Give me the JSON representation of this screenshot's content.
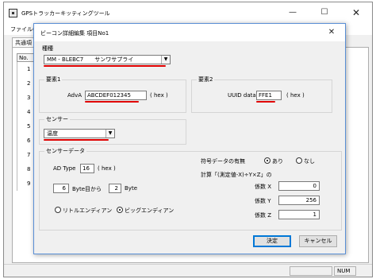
{
  "main_window": {
    "title": "GPSトラッカーキッティングツール",
    "menu_file": "ファイル(",
    "tab_label": "共通項",
    "table_header": "No.",
    "row_numbers": [
      "1",
      "2",
      "3",
      "4",
      "5",
      "6",
      "7",
      "8",
      "9"
    ],
    "status_num": "NUM"
  },
  "dialog": {
    "title": "ビーコン詳細編集 項目No1",
    "type_group": {
      "title": "種種",
      "combo_value": "MM - BLEBC7　　サンワサプライ"
    },
    "element1": {
      "title": "要素1",
      "label": "AdvA",
      "value": "ABCDEF012345",
      "unit": "( hex )"
    },
    "element2": {
      "title": "要素2",
      "label": "UUID data",
      "value": "FFE1",
      "unit": "( hex )"
    },
    "sensor": {
      "title": "センサー",
      "value": "温度"
    },
    "sensor_data": {
      "title": "センサーデータ",
      "ad_type_label": "AD Type",
      "ad_type_value": "16",
      "ad_type_unit": "( hex )",
      "byte_start_value": "6",
      "byte_start_label": "Byte目から",
      "byte_len_value": "2",
      "byte_len_label": "Byte",
      "little_endian_label": "リトルエンディアン",
      "big_endian_label": "ビッグエンディアン",
      "sign_label": "符号データの有無",
      "sign_yes": "あり",
      "sign_no": "なし",
      "formula_label": "計算「(測定値-X)÷Y×Z」の",
      "coef_x_label": "係数 X",
      "coef_x_value": "0",
      "coef_y_label": "係数 Y",
      "coef_y_value": "256",
      "coef_z_label": "係数 Z",
      "coef_z_value": "1"
    },
    "ok_label": "決定",
    "cancel_label": "キャンセル"
  },
  "colors": {
    "highlight_underline": "#e00000",
    "dialog_border": "#5a8fd6",
    "default_button_border": "#0078d7"
  },
  "icons": {
    "app": "app-icon",
    "minimize": "minimize-icon",
    "maximize": "maximize-icon",
    "close": "close-icon",
    "dropdown": "chevron-down-icon"
  }
}
